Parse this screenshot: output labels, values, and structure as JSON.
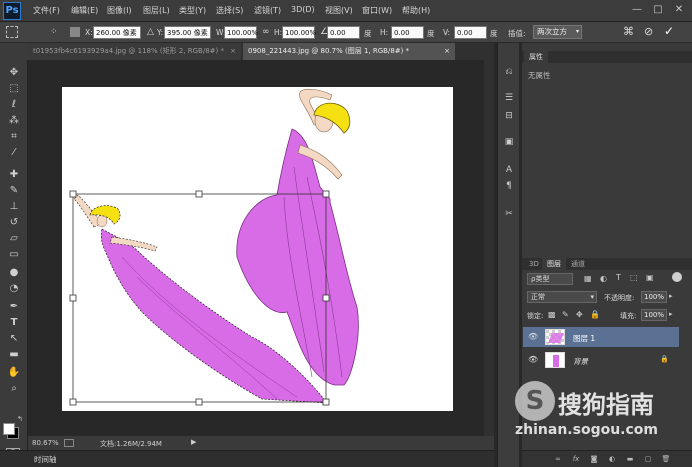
{
  "app": {
    "logo": "Ps"
  },
  "menubar": {
    "items": [
      "文件(F)",
      "编辑(E)",
      "图像(I)",
      "图层(L)",
      "类型(Y)",
      "选择(S)",
      "滤镜(T)",
      "3D(D)",
      "视图(V)",
      "窗口(W)",
      "帮助(H)"
    ],
    "window_controls": [
      "—",
      "□",
      "✕"
    ]
  },
  "options": {
    "x_label": "X:",
    "x_value": "260.00 像素",
    "y_label": "Y:",
    "y_value": "395.00 像素",
    "w_label": "W:",
    "w_value": "100.00%",
    "h_label": "H:",
    "h_value": "100.00%",
    "angle_value": "0.00",
    "angle_unit": "度",
    "hskew_label": "H:",
    "hskew_value": "0.00",
    "hskew_unit": "度",
    "vskew_label": "V:",
    "vskew_value": "0.00",
    "vskew_unit": "度",
    "interp_label": "插值:",
    "interp_value": "两次立方"
  },
  "tabs": [
    {
      "label": "t01953fb4c6193929a4.jpg @ 118% (矩形 2, RGB/8#) *",
      "active": false,
      "close": "×"
    },
    {
      "label": "0908_221443.jpg @ 80.7% (图层 1, RGB/8#) *",
      "active": true,
      "close": "×"
    }
  ],
  "status": {
    "zoom": "80.67%",
    "doc": "文档:1.26M/2.94M"
  },
  "timeline": {
    "label": "时间轴"
  },
  "properties": {
    "tab": "属性",
    "text": "无属性"
  },
  "layers_panel": {
    "tabs": [
      "3D",
      "图层",
      "通道"
    ],
    "filter_label": "ρ类型",
    "blend_mode": "正常",
    "opacity_label": "不透明度:",
    "opacity_value": "100%",
    "lock_label": "锁定:",
    "fill_label": "填充:",
    "fill_value": "100%",
    "layers": [
      {
        "name": "图层 1",
        "selected": true,
        "lock": ""
      },
      {
        "name": "背景",
        "selected": false,
        "lock": "🔒"
      }
    ]
  },
  "watermark": {
    "brand": "搜狗指南",
    "url": "zhinan.sogou.com"
  },
  "colors": {
    "dress": "#d86be6",
    "hair": "#f5e012",
    "skin": "#f3d9c4",
    "accent": "#4ea3ff",
    "layer_selected": "#5a7194"
  }
}
